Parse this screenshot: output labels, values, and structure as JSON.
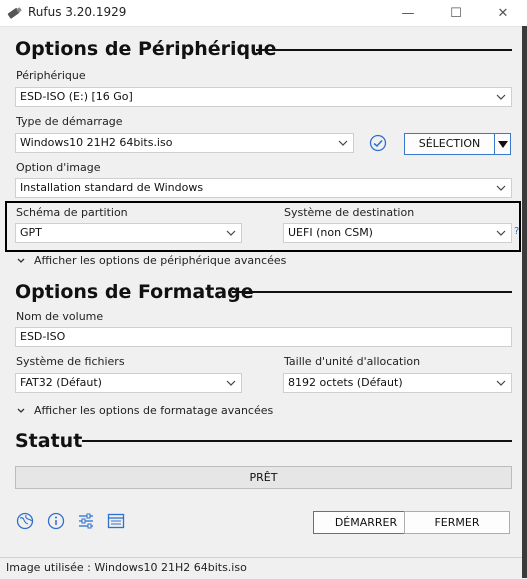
{
  "window": {
    "title": "Rufus 3.20.1929",
    "minimize": "—",
    "maximize": "☐",
    "close": "✕"
  },
  "device_options": {
    "title": "Options de Périphérique",
    "device_label": "Périphérique",
    "device_value": "ESD-ISO (E:) [16 Go]",
    "boot_label": "Type de démarrage",
    "boot_value": "Windows10 21H2 64bits.iso",
    "select_button": "SÉLECTION",
    "image_label": "Option d'image",
    "image_value": "Installation standard de Windows",
    "partition_label": "Schéma de partition",
    "partition_value": "GPT",
    "target_label": "Système de destination",
    "target_value": "UEFI (non CSM)",
    "help_glyph": "?",
    "advanced_toggle": "Afficher les options de périphérique avancées"
  },
  "format_options": {
    "title": "Options de Formatage",
    "volume_label": "Nom de volume",
    "volume_value": "ESD-ISO",
    "filesystem_label": "Système de fichiers",
    "filesystem_value": "FAT32 (Défaut)",
    "cluster_label": "Taille d'unité d'allocation",
    "cluster_value": "8192 octets (Défaut)",
    "advanced_toggle": "Afficher les options de formatage avancées"
  },
  "status": {
    "title": "Statut",
    "progress_text": "PRÊT",
    "progress_fraction": 0
  },
  "actions": {
    "start_button": "DÉMARRER",
    "close_button": "FERMER"
  },
  "toolbar_icons": [
    "globe-icon",
    "info-icon",
    "settings-sliders-icon",
    "log-icon"
  ],
  "statusbar": {
    "text": "Image utilisée : Windows10 21H2 64bits.iso"
  },
  "colors": {
    "accent": "#3a78c9",
    "check": "#2f6fd0",
    "background": "#f0f0f0"
  }
}
